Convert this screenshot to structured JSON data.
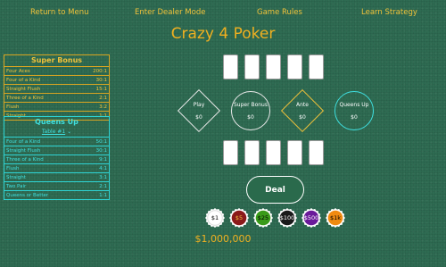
{
  "nav": {
    "return": "Return to Menu",
    "dealer": "Enter Dealer Mode",
    "rules": "Game Rules",
    "strategy": "Learn Strategy"
  },
  "title": "Crazy 4 Poker",
  "super_bonus": {
    "title": "Super Bonus",
    "rows": [
      {
        "hand": "Four Aces",
        "pay": "200:1"
      },
      {
        "hand": "Four of a Kind",
        "pay": "30:1"
      },
      {
        "hand": "Straight Flush",
        "pay": "15:1"
      },
      {
        "hand": "Three of a Kind",
        "pay": "2:1"
      },
      {
        "hand": "Flush",
        "pay": "3:2"
      },
      {
        "hand": "Straight",
        "pay": "1:1"
      }
    ]
  },
  "queens_up": {
    "title": "Queens Up",
    "table_label": "Table #1",
    "rows": [
      {
        "hand": "Four of a Kind",
        "pay": "50:1"
      },
      {
        "hand": "Straight Flush",
        "pay": "30:1"
      },
      {
        "hand": "Three of a Kind",
        "pay": "9:1"
      },
      {
        "hand": "Flush",
        "pay": "4:1"
      },
      {
        "hand": "Straight",
        "pay": "3:1"
      },
      {
        "hand": "Two Pair",
        "pay": "2:1"
      },
      {
        "hand": "Queens or Better",
        "pay": "1:1"
      }
    ]
  },
  "bets": {
    "play": {
      "label": "Play",
      "amount": "$0"
    },
    "super_bonus": {
      "label": "Super Bonus",
      "amount": "$0"
    },
    "ante": {
      "label": "Ante",
      "amount": "$0"
    },
    "queens_up": {
      "label": "Queens Up",
      "amount": "$0"
    }
  },
  "deal_label": "Deal",
  "chips": [
    {
      "label": "$1",
      "color": "#ffffff",
      "text": "#000000"
    },
    {
      "label": "$5",
      "color": "#8b1a1a",
      "text": "#f0c23a"
    },
    {
      "label": "$25",
      "color": "#3a9a1a",
      "text": "#000000"
    },
    {
      "label": "$100",
      "color": "#1a1a1a",
      "text": "#ffffff"
    },
    {
      "label": "$500",
      "color": "#6a1a9a",
      "text": "#ffffff"
    },
    {
      "label": "$1k",
      "color": "#f08a10",
      "text": "#000000"
    }
  ],
  "bankroll": "$1,000,000",
  "colors": {
    "gold": "#f0c23a",
    "cyan": "#3fe0e0",
    "felt": "#2e6b52"
  }
}
